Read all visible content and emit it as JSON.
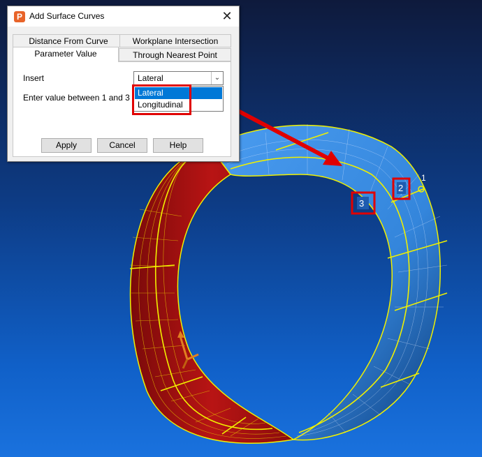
{
  "dialog": {
    "title": "Add Surface Curves",
    "app_icon_glyph": "P",
    "close_glyph": "✕",
    "tabs": [
      {
        "label": "Distance From Curve"
      },
      {
        "label": "Workplane Intersection"
      },
      {
        "label": "Parameter Value"
      },
      {
        "label": "Through Nearest Point"
      }
    ],
    "active_tab": "Parameter Value",
    "insert_label": "Insert",
    "insert_value": "Lateral",
    "insert_options": [
      "Lateral",
      "Longitudinal"
    ],
    "enter_label": "Enter value between 1 and 3",
    "buttons": {
      "apply": "Apply",
      "cancel": "Cancel",
      "help": "Help"
    }
  },
  "viewport": {
    "markers": [
      "1",
      "2",
      "3"
    ],
    "colors": {
      "inner_surface": "#b01010",
      "outer_surface": "#3a8de0",
      "mesh_lines": "#f0f000",
      "annotation": "#e00000"
    }
  }
}
